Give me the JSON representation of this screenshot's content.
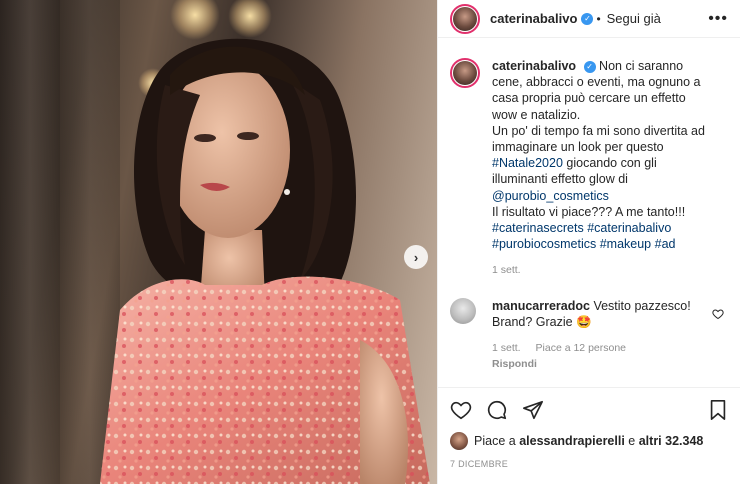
{
  "post": {
    "author": "caterinabalivo",
    "follow_label": "Segui già",
    "more_icon": "more-horizontal-icon"
  },
  "caption": {
    "author": "caterinabalivo",
    "text_1": "Non ci saranno cene, abbracci o eventi, ma ognuno a casa propria può cercare un effetto wow e natalizio.",
    "text_2": "Un po' di tempo fa mi sono divertita ad immaginare un look per questo",
    "tag_natale": "#Natale2020",
    "text_3": "giocando con gli illuminanti effetto glow di",
    "mention": "@purobio_cosmetics",
    "text_4": "Il risultato vi piace??? A me tanto!!!",
    "tag_1": "#caterinasecrets",
    "tag_2": "#caterinabalivo",
    "tag_3": "#purobiocosmetics",
    "tag_4": "#makeup",
    "tag_5": "#ad",
    "time": "1 sett."
  },
  "comment": {
    "author": "manucarreradoc",
    "text": "Vestito pazzesco! Brand? Grazie",
    "emoji": "🤩",
    "time": "1 sett.",
    "likes": "Piace a 12 persone",
    "reply": "Rispondi"
  },
  "likes": {
    "prefix": "Piace a",
    "user": "alessandrapierelli",
    "middle": "e",
    "others": "altri 32.348"
  },
  "date": "7 DICEMBRE",
  "colors": {
    "accent_link": "#00376b",
    "verified": "#3897f0",
    "muted": "#8e8e8e"
  }
}
